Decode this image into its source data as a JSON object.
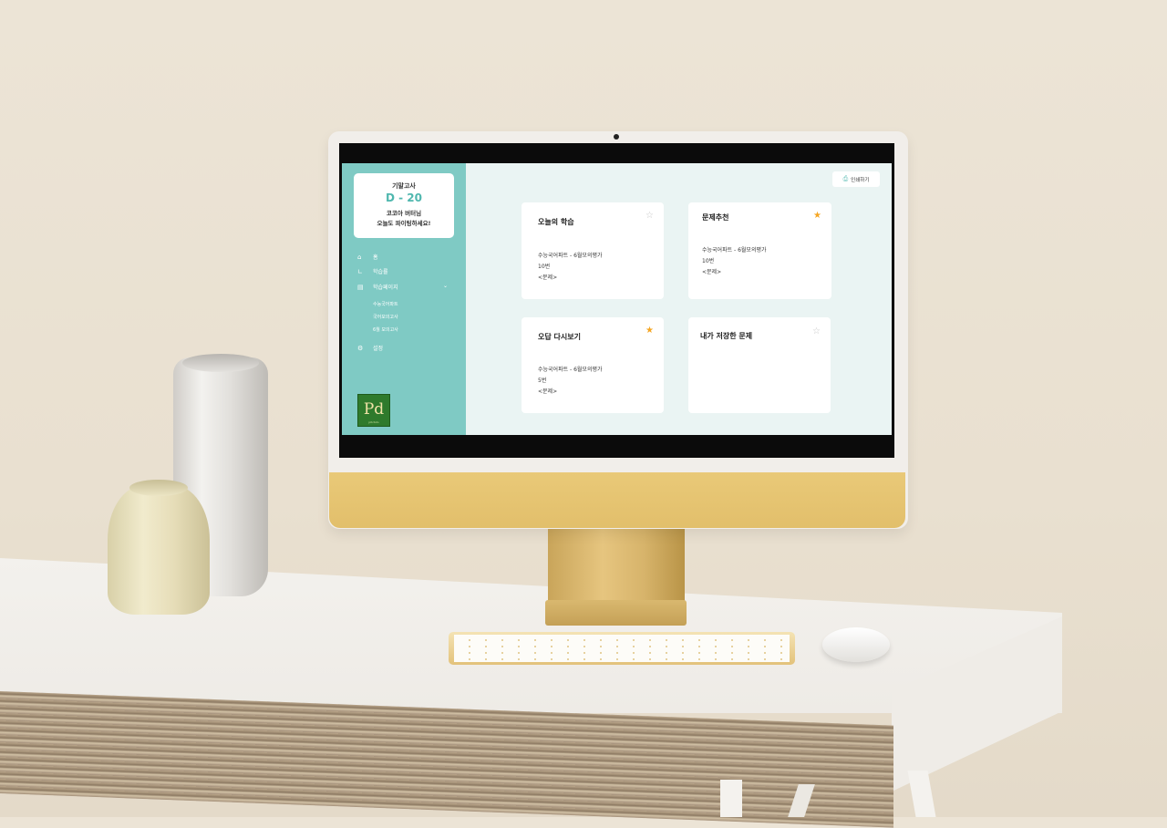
{
  "colors": {
    "accent": "#7fcac4",
    "accent_dark": "#4fb7ae",
    "star_on": "#f5a623",
    "star_off": "#c8c8c8",
    "screen_bg": "#eaf4f3"
  },
  "sidebar": {
    "exam_label": "기말고사",
    "dday": "D - 20",
    "greeting_line1": "코코아 버터님",
    "greeting_line2": "오늘도 파이팅하세요!",
    "nav": [
      {
        "label": "홈",
        "icon": "home-icon"
      },
      {
        "label": "학습률",
        "icon": "chart-icon"
      },
      {
        "label": "학습페이지",
        "icon": "book-icon"
      }
    ],
    "sub_items": [
      "수능국어파트",
      "국어모의고사",
      "6월 모의고사"
    ],
    "settings_label": "설정",
    "logo_text": "Pd",
    "logo_small": "pitchdo"
  },
  "toolbar": {
    "print_label": "인쇄하기"
  },
  "cards": [
    {
      "title": "오늘의 학습",
      "starred": false,
      "lines": [
        "수능국어파트 - 6월모의평가",
        "10번",
        "<문제>"
      ]
    },
    {
      "title": "문제추천",
      "starred": true,
      "lines": [
        "수능국어파트 - 6월모의평가",
        "10번",
        "<문제>"
      ]
    },
    {
      "title": "오답 다시보기",
      "starred": true,
      "lines": [
        "수능국어파트 - 6월모의평가",
        "5번",
        "<문제>"
      ]
    },
    {
      "title": "내가 저장한 문제",
      "starred": false,
      "lines": []
    }
  ]
}
